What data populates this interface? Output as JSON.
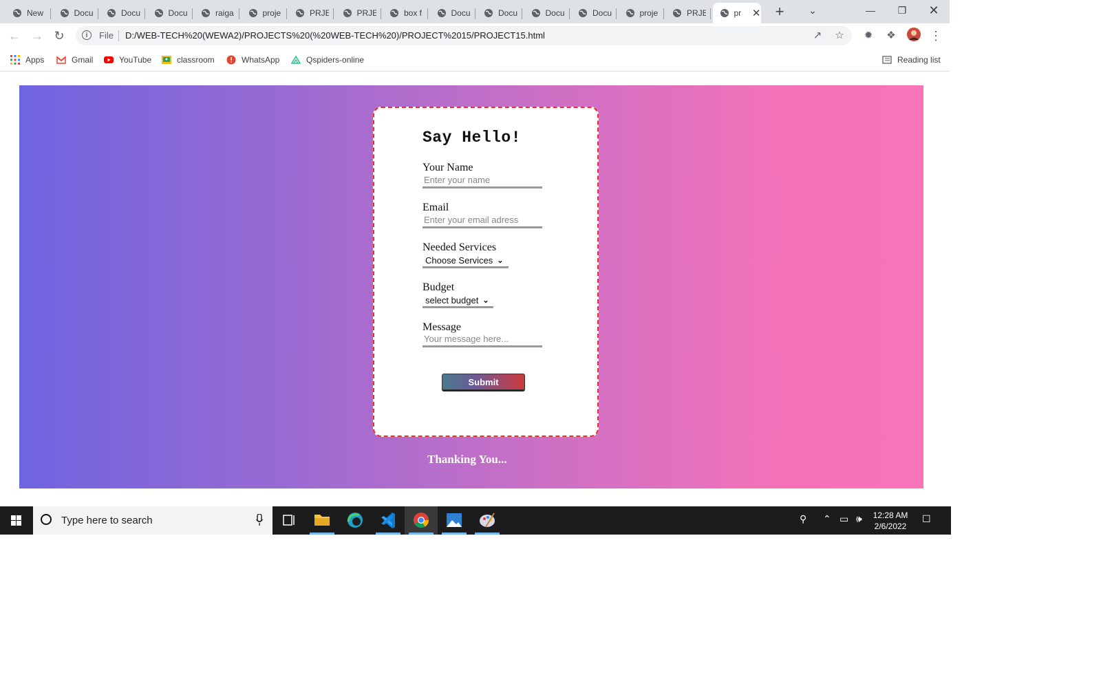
{
  "browser": {
    "tabs": [
      {
        "title": "New"
      },
      {
        "title": "Docu"
      },
      {
        "title": "Docu"
      },
      {
        "title": "Docu"
      },
      {
        "title": "raiga"
      },
      {
        "title": "proje"
      },
      {
        "title": "PRJE("
      },
      {
        "title": "PRJE("
      },
      {
        "title": "box f"
      },
      {
        "title": "Docu"
      },
      {
        "title": "Docu"
      },
      {
        "title": "Docu"
      },
      {
        "title": "Docu"
      },
      {
        "title": "proje"
      },
      {
        "title": "PRJE("
      },
      {
        "title": "pr"
      }
    ],
    "url_scheme_label": "File",
    "url": "D:/WEB-TECH%20(WEWA2)/PROJECTS%20(%20WEB-TECH%20)/PROJECT%2015/PROJECT15.html",
    "bookmarks": [
      {
        "label": "Apps",
        "icon": "apps-grid-icon"
      },
      {
        "label": "Gmail",
        "icon": "gmail-icon"
      },
      {
        "label": "YouTube",
        "icon": "youtube-icon"
      },
      {
        "label": "classroom",
        "icon": "classroom-icon"
      },
      {
        "label": "WhatsApp",
        "icon": "whatsapp-icon"
      },
      {
        "label": "Qspiders-online",
        "icon": "qspiders-icon"
      }
    ],
    "reading_list_label": "Reading list"
  },
  "form": {
    "heading": "Say Hello!",
    "name_label": "Your Name",
    "name_placeholder": "Enter your name",
    "email_label": "Email",
    "email_placeholder": "Enter your email adress",
    "services_label": "Needed Services",
    "services_selected": "Choose Services",
    "budget_label": "Budget",
    "budget_selected": "select budget",
    "message_label": "Message",
    "message_placeholder": "Your message here...",
    "submit_label": "Submit",
    "footer_text": "Thanking You..."
  },
  "taskbar": {
    "search_placeholder": "Type here to search",
    "time": "12:28 AM",
    "date": "2/6/2022"
  },
  "colors": {
    "gradient_start": "#6f64e0",
    "gradient_end": "#f874b8",
    "card_border": "#e8332b"
  }
}
